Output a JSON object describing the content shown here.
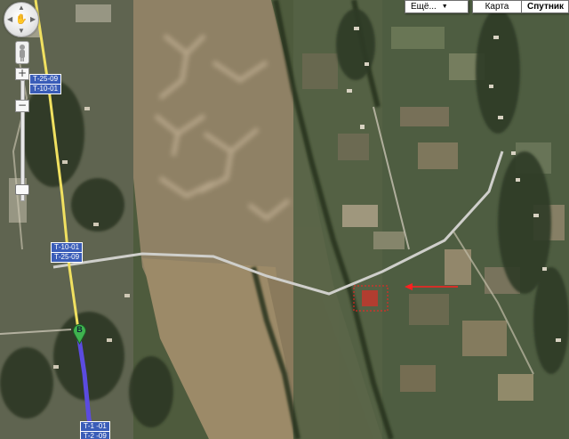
{
  "map_type_bar": {
    "more_label": "Ещё...",
    "map_label": "Карта",
    "satellite_label": "Спутник",
    "active": "Спутник"
  },
  "navigation": {
    "pan_icon": "hand-icon",
    "zoom_in_label": "+",
    "zoom_out_label": "−",
    "zoom_level_fraction": 0.9
  },
  "road_labels": {
    "top": [
      "Т-25-09",
      "Т-10-01"
    ],
    "middle": [
      "Т-10-01",
      "Т-25-09"
    ],
    "bottom": [
      "Т-1 -01",
      "Т-2 -09"
    ]
  },
  "marker": {
    "label": "B",
    "color": "#3fb34f"
  },
  "colors": {
    "route": "#5b4be0",
    "highway": "#f0e060",
    "annotation": "#ff2020",
    "road_badge": "#3a5db8"
  }
}
